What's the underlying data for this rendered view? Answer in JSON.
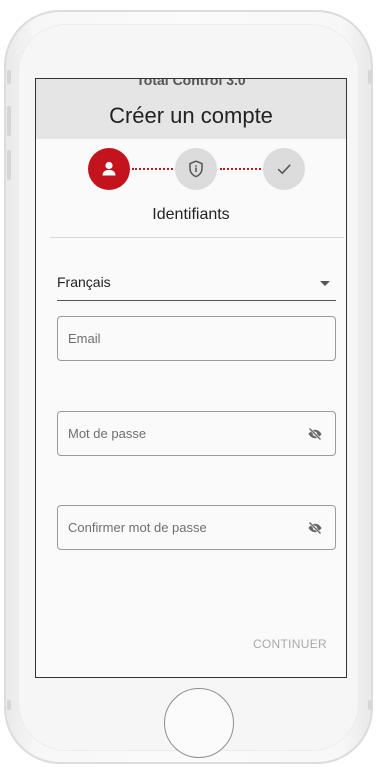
{
  "app": {
    "name": "Total Control 3.0",
    "title": "Créer un compte"
  },
  "stepper": {
    "steps": [
      {
        "icon": "person-icon",
        "state": "active"
      },
      {
        "icon": "shield-icon",
        "state": "inactive"
      },
      {
        "icon": "check-icon",
        "state": "inactive"
      }
    ],
    "current_label": "Identifiants"
  },
  "form": {
    "language": {
      "value": "Français"
    },
    "email": {
      "placeholder": "Email",
      "value": ""
    },
    "password": {
      "placeholder": "Mot de passe",
      "value": ""
    },
    "confirm_password": {
      "placeholder": "Confirmer mot de passe",
      "value": ""
    },
    "continue_label": "CONTINUER"
  },
  "colors": {
    "accent": "#c3141e",
    "inactive_step": "#dcdcdc",
    "header_bg": "#e5e5e5",
    "disabled_text": "#a9a9a9"
  }
}
